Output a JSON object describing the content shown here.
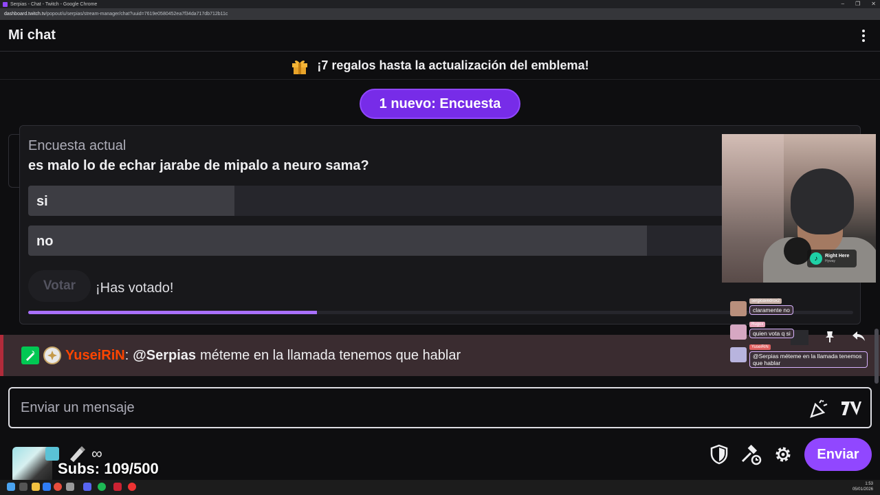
{
  "window": {
    "title": "Serpias - Chat - Twitch - Google Chrome",
    "url_domain": "dashboard.twitch.tv",
    "url_path": "/popout/u/serpias/stream-manager/chat?uuid=7619e0580452ea7f34da717db712b11c",
    "controls": [
      "–",
      "❐",
      "✕"
    ]
  },
  "header": {
    "title": "Mi chat"
  },
  "banner": {
    "text": "¡7 regalos hasta la actualización del emblema!"
  },
  "new_notice": {
    "label": "1 nuevo: Encuesta"
  },
  "poll": {
    "label": "Encuesta actual",
    "question": "es malo lo de echar jarabe de mipalo a neuro sama?",
    "options": [
      {
        "label": "si",
        "fraction": 0.25
      },
      {
        "label": "no",
        "fraction": 0.75
      }
    ],
    "vote_button": "Votar",
    "voted_text": "¡Has votado!",
    "time_progress": 0.35
  },
  "chat_message": {
    "user": "YuseiRiN",
    "colon": ":",
    "mention": "@Serpias",
    "body": "méteme en la llamada tenemos que hablar"
  },
  "input": {
    "placeholder": "Enviar un mensaje"
  },
  "footer": {
    "infinity": "∞",
    "subs": "Subs: 109/500",
    "send": "Enviar"
  },
  "overlay": {
    "now_playing_title": "Right Here",
    "now_playing_artist": "Hyway",
    "chats": [
      {
        "name": "sergioavedrox2",
        "text": "claramente no"
      },
      {
        "name": "Rugox",
        "text": "quien vota q si"
      },
      {
        "name": "YuseiRiN",
        "text": "@Serpias méteme en la llamada tenemos que hablar"
      }
    ]
  },
  "taskbar": {
    "time": "1:53",
    "date": "05/01/2026"
  },
  "colors": {
    "accent": "#9147ff",
    "pill": "#772ce8",
    "username": "#ff4500",
    "highlight_bg": "#3a2c30",
    "highlight_border": "#b12b3a"
  }
}
